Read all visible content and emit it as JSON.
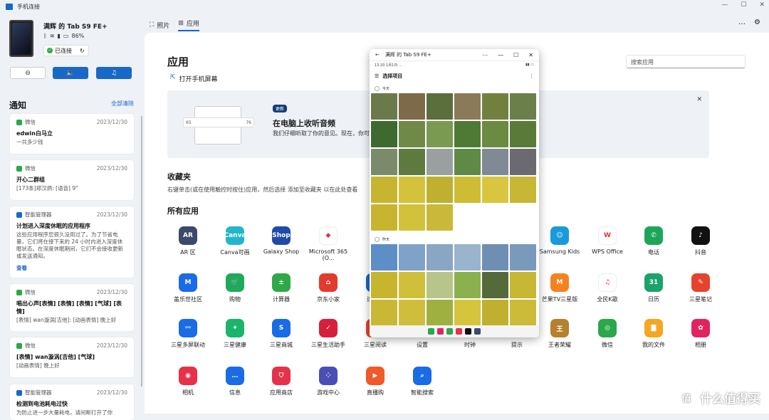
{
  "window": {
    "title": "手机连接"
  },
  "device": {
    "name": "满辉 的 Tab S9 FE+",
    "battery": "86%",
    "status": "已连接"
  },
  "notifications": {
    "title": "通知",
    "clear_all": "全部清除",
    "items": [
      {
        "app": "微信",
        "time": "2023/12/30",
        "title": "edwin白马立",
        "body": "一共多少钱",
        "color": "#2aa84a"
      },
      {
        "app": "微信",
        "time": "2023/12/30",
        "title": "开心二群组",
        "body": "[173条]郑汉炳: [语音] 9\"",
        "color": "#2aa84a"
      },
      {
        "app": "智能管理器",
        "time": "2023/12/30",
        "title": "计划进入深度休眠的应用程序",
        "body": "这些应用程序您很久没用过了。为了节省电量，它们将在接下来的 24 小时内进入深度休眠状态。在深度休眠期间，它们不会接收更新或发送通知。",
        "link": "查看",
        "color": "#1868c8"
      },
      {
        "app": "微信",
        "time": "2023/12/30",
        "title": "唱出心声[表情] [表情] [表情] [气球] [表情]",
        "body": "[表情] wan漩涡[吉他]: [动画表情] 晚上好",
        "color": "#2aa84a"
      },
      {
        "app": "微信",
        "time": "2023/12/30",
        "title": "[表情] wan漩涡[吉他] [气球]",
        "body": "[动画表情] 晚上好",
        "color": "#2aa84a"
      },
      {
        "app": "智能管理器",
        "time": "2023/12/30",
        "title": "检测到电池耗电过快",
        "body": "为防止进一步大量耗电，请间断打开了你",
        "color": "#1868c8"
      }
    ]
  },
  "nav": {
    "tab_photos": "照片",
    "tab_apps": "应用"
  },
  "main": {
    "title": "应用",
    "open_screen": "打开手机屏幕",
    "search_placeholder": "搜索应用",
    "banner": {
      "badge": "更新",
      "title": "在电脑上收听音频",
      "text": "我们仔细听取了你的意见。现在，你可",
      "slider_min": "65",
      "slider_max": "76"
    },
    "favorites_title": "收藏夹",
    "favorites_desc": "右键单击(或在使用触控时按住)应用，然后选择 添加至收藏夹 以在此处查看",
    "all_apps_title": "所有应用"
  },
  "apps": [
    {
      "name": "AR 区",
      "color": "#3b4a6b",
      "glyph": "AR"
    },
    {
      "name": "Canva可画",
      "color": "#21b6c9",
      "glyph": "Canva"
    },
    {
      "name": "Galaxy Shop",
      "color": "#1f4aa8",
      "glyph": "Shop"
    },
    {
      "name": "Microsoft 365 (O...",
      "color": "#ffffff",
      "glyph": "◆"
    },
    {
      "name": "Samsung Kids",
      "color": "#1a9bd9",
      "glyph": "☺"
    },
    {
      "name": "WPS Office",
      "color": "#ffffff",
      "glyph": "W"
    },
    {
      "name": "电话",
      "color": "#1da65a",
      "glyph": "✆"
    },
    {
      "name": "抖音",
      "color": "#111111",
      "glyph": "♪"
    },
    {
      "name": "盖乐世社区",
      "color": "#1a6be6",
      "glyph": "M"
    },
    {
      "name": "购物",
      "color": "#1faa59",
      "glyph": "🛒"
    },
    {
      "name": "计算器",
      "color": "#2fa84a",
      "glyph": "±"
    },
    {
      "name": "京东小家",
      "color": "#e23b2e",
      "glyph": "⌂"
    },
    {
      "name": "连接...",
      "color": "#1868c8",
      "glyph": "⇄"
    },
    {
      "name": "芒果TV三星版",
      "color": "#f58220",
      "glyph": "M"
    },
    {
      "name": "全民K歌",
      "color": "#ffffff",
      "glyph": "♫"
    },
    {
      "name": "日历",
      "color": "#1aa36a",
      "glyph": "31"
    },
    {
      "name": "三星笔记",
      "color": "#e5432e",
      "glyph": "✎"
    },
    {
      "name": "三星多屏联动",
      "color": "#1a6be6",
      "glyph": "⚯"
    },
    {
      "name": "三星健康",
      "color": "#1ab56b",
      "glyph": "✦"
    },
    {
      "name": "三星商城",
      "color": "#1a6be6",
      "glyph": "S"
    },
    {
      "name": "三星生活助手",
      "color": "#d61f3c",
      "glyph": "✓"
    },
    {
      "name": "三星阅读",
      "color": "#e5432e",
      "glyph": "▤"
    },
    {
      "name": "设置",
      "color": "#6b7486",
      "glyph": "⚙"
    },
    {
      "name": "时钟",
      "color": "#3c4b6a",
      "glyph": "◷"
    },
    {
      "name": "提示",
      "color": "#f0a020",
      "glyph": "?"
    },
    {
      "name": "王者荣耀",
      "color": "#b5812c",
      "glyph": "王"
    },
    {
      "name": "微信",
      "color": "#2aa84a",
      "glyph": "◎",
      "badge": "4"
    },
    {
      "name": "我的文件",
      "color": "#f5a623",
      "glyph": "▇"
    },
    {
      "name": "相册",
      "color": "#e0245e",
      "glyph": "✿"
    },
    {
      "name": "相机",
      "color": "#e5324a",
      "glyph": "◉"
    },
    {
      "name": "信息",
      "color": "#1a6be6",
      "glyph": "…"
    },
    {
      "name": "应用商店",
      "color": "#e5324a",
      "glyph": "⛉"
    },
    {
      "name": "游戏中心",
      "color": "#4a4fb5",
      "glyph": "⁘"
    },
    {
      "name": "直播购",
      "color": "#f05a28",
      "glyph": "▶"
    },
    {
      "name": "智能搜索",
      "color": "#1a6be6",
      "glyph": "⌕"
    }
  ],
  "phone_window": {
    "title": "满辉 的 Tab S9 FE+",
    "status_left": "13:20  1月1日 ...",
    "select_label": "选择项目",
    "section_today": "今天",
    "section_yesterday": "昨天",
    "photo_colors_a": [
      "#6a7a4a",
      "#7c6a4a",
      "#5a6f3b",
      "#8a7a5a",
      "#72803e",
      "#6b7f4a",
      "#3f6a2f",
      "#6f8a48",
      "#7a9a52",
      "#4f7a35",
      "#6b8a42",
      "#5a7a3a",
      "#7a8a6a",
      "#5f7a3f",
      "#9aa0a0",
      "#5f8a45",
      "#7f8a95",
      "#6a6a70",
      "#c7b530",
      "#d4c23a",
      "#c0b030",
      "#cfbc35",
      "#d8c640",
      "#c6b734",
      "#c7b530",
      "#d2c13a",
      "#cab83a"
    ],
    "photo_colors_b": [
      "#5d8fc7",
      "#7fa2c8",
      "#8aa6c3",
      "#9ab4cd",
      "#6f8fb2",
      "#7a9abc",
      "#c7b530",
      "#d0bf3a",
      "#b7c48a",
      "#8ab050",
      "#556a3a",
      "#c6b734",
      "#c8b836",
      "#cebe3c",
      "#a0b040",
      "#d5c53c",
      "#c0b030",
      "#cbbb38"
    ]
  }
}
